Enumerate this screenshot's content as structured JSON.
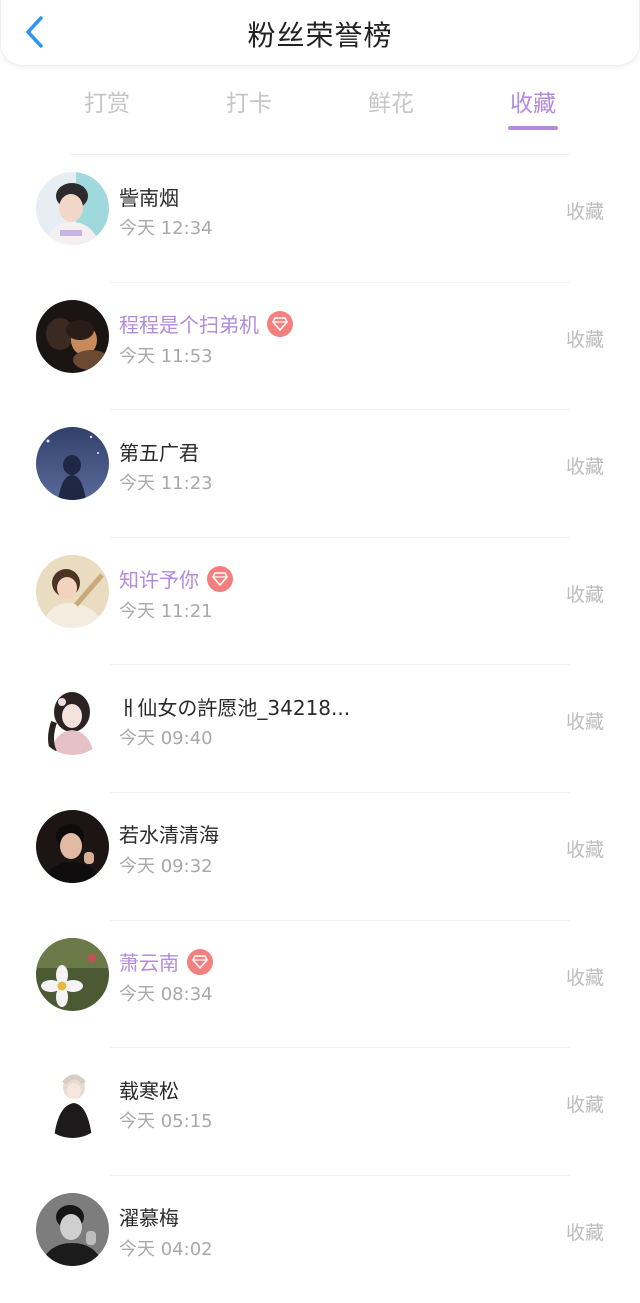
{
  "header": {
    "title": "粉丝荣誉榜",
    "back_icon": "chevron-left-icon",
    "back_color": "#2f96f2"
  },
  "tabs": [
    {
      "label": "打赏",
      "active": false
    },
    {
      "label": "打卡",
      "active": false
    },
    {
      "label": "鲜花",
      "active": false
    },
    {
      "label": "收藏",
      "active": true
    }
  ],
  "colors": {
    "accent": "#b28bdc",
    "vip_badge": "#f3807e",
    "muted": "#a9a9a9"
  },
  "list": {
    "items": [
      {
        "name": "訾南烟",
        "vip": false,
        "time": "今天 12:34",
        "action": "收藏",
        "avatar_icon": "avatar-boy-photo"
      },
      {
        "name": "程程是个扫弟机",
        "vip": true,
        "time": "今天 11:53",
        "action": "收藏",
        "avatar_icon": "avatar-dark-couple-photo"
      },
      {
        "name": "第五广君",
        "vip": false,
        "time": "今天 11:23",
        "action": "收藏",
        "avatar_icon": "avatar-night-sky-photo"
      },
      {
        "name": "知许予你",
        "vip": true,
        "time": "今天 11:21",
        "action": "收藏",
        "avatar_icon": "avatar-girl-photo"
      },
      {
        "name": "ㅐ仙女の許愿池_34218...",
        "vip": false,
        "time": "今天 09:40",
        "action": "收藏",
        "avatar_icon": "avatar-illustrated-girl"
      },
      {
        "name": "若水清清海",
        "vip": false,
        "time": "今天 09:32",
        "action": "收藏",
        "avatar_icon": "avatar-man-photo"
      },
      {
        "name": "萧云南",
        "vip": true,
        "time": "今天 08:34",
        "action": "收藏",
        "avatar_icon": "avatar-white-flower-photo"
      },
      {
        "name": "载寒松",
        "vip": false,
        "time": "今天 05:15",
        "action": "收藏",
        "avatar_icon": "avatar-anime-figure"
      },
      {
        "name": "濯慕梅",
        "vip": false,
        "time": "今天 04:02",
        "action": "收藏",
        "avatar_icon": "avatar-man-mono-photo"
      }
    ]
  }
}
